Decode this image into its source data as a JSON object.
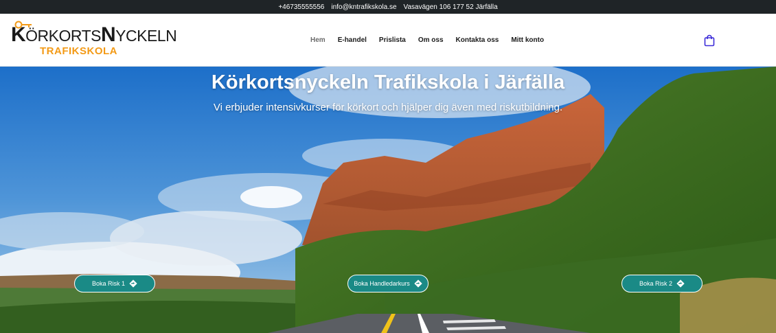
{
  "topbar": {
    "phone": "+46735555556",
    "email": "info@kntrafikskola.se",
    "address": "Vasavägen 106 177 52 Järfälla"
  },
  "logo": {
    "line1_first_letter": "K",
    "line1_rest_a": "ÖRKORTS",
    "line1_big_letter": "N",
    "line1_rest_b": "YCKELN",
    "line2": "TRAFIKSKOLA",
    "brand_color": "#f39a16"
  },
  "nav": {
    "items": [
      "Hem",
      "E-handel",
      "Prislista",
      "Om oss",
      "Kontakta oss",
      "Mitt konto"
    ],
    "active": "Hem"
  },
  "cart": {
    "icon": "shopping-bag-icon",
    "color": "#3b2bd8"
  },
  "hero": {
    "title": "Körkortsnyckeln Trafikskola i Järfälla",
    "subtitle": "Vi erbjuder intensivkurser för körkort och hjälper dig även med riskutbildning.",
    "buttons": [
      {
        "label": "Boka Risk 1",
        "icon": "directions-icon"
      },
      {
        "label": "Boka Handledarkurs",
        "icon": "directions-icon"
      },
      {
        "label": "Boka Risk 2",
        "icon": "directions-icon"
      }
    ],
    "button_color": "#1a8a86"
  }
}
